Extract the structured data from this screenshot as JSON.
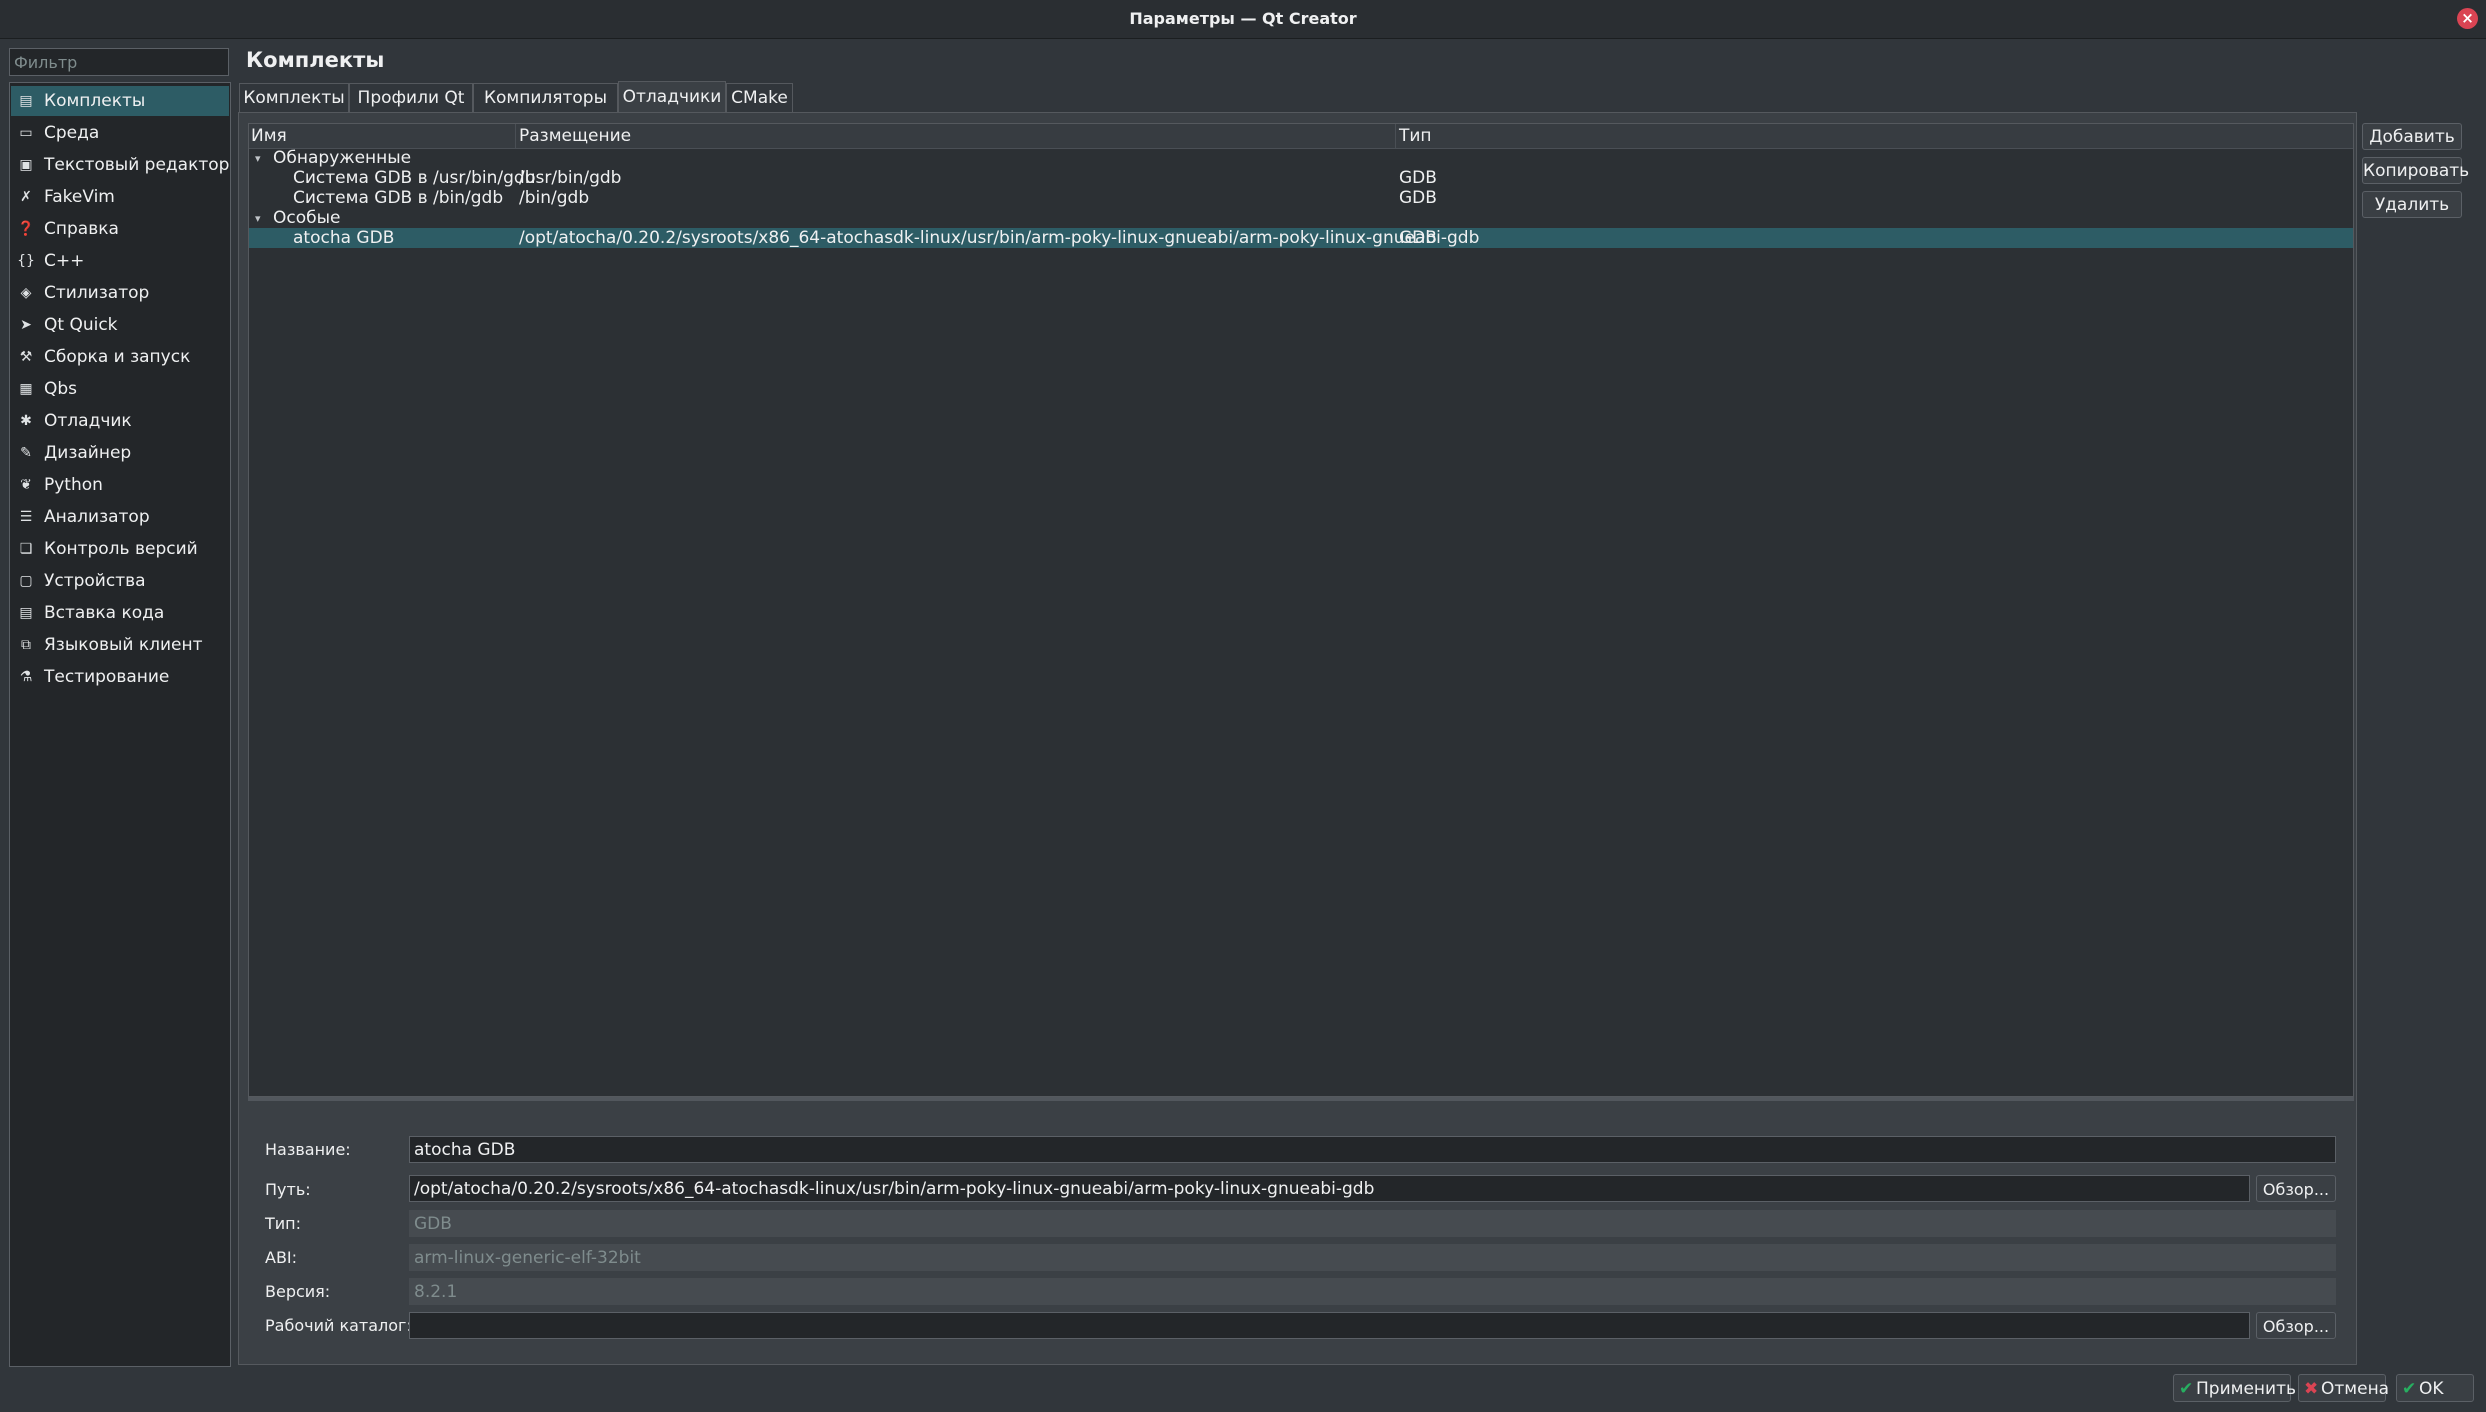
{
  "window": {
    "title": "Параметры — Qt Creator",
    "close_icon": "close-icon"
  },
  "sidebar": {
    "filter_placeholder": "Фильтр",
    "items": [
      {
        "label": "Комплекты",
        "icon": "kits-icon",
        "glyph": "▤"
      },
      {
        "label": "Среда",
        "icon": "monitor-icon",
        "glyph": "▭"
      },
      {
        "label": "Текстовый редактор",
        "icon": "text-editor-icon",
        "glyph": "▣"
      },
      {
        "label": "FakeVim",
        "icon": "fakevim-icon",
        "glyph": "✗"
      },
      {
        "label": "Справка",
        "icon": "help-icon",
        "glyph": "❓"
      },
      {
        "label": "C++",
        "icon": "braces-icon",
        "glyph": "{}"
      },
      {
        "label": "Стилизатор",
        "icon": "diamond-icon",
        "glyph": "◈"
      },
      {
        "label": "Qt Quick",
        "icon": "send-icon",
        "glyph": "➤"
      },
      {
        "label": "Сборка и запуск",
        "icon": "hammer-icon",
        "glyph": "⚒"
      },
      {
        "label": "Qbs",
        "icon": "qbs-icon",
        "glyph": "▦"
      },
      {
        "label": "Отладчик",
        "icon": "bug-icon",
        "glyph": "✱"
      },
      {
        "label": "Дизайнер",
        "icon": "pencil-icon",
        "glyph": "✎"
      },
      {
        "label": "Python",
        "icon": "python-icon",
        "glyph": "❦"
      },
      {
        "label": "Анализатор",
        "icon": "analyzer-icon",
        "glyph": "☰"
      },
      {
        "label": "Контроль версий",
        "icon": "version-control-icon",
        "glyph": "❏"
      },
      {
        "label": "Устройства",
        "icon": "devices-icon",
        "glyph": "▢"
      },
      {
        "label": "Вставка кода",
        "icon": "code-paste-icon",
        "glyph": "▤"
      },
      {
        "label": "Языковый клиент",
        "icon": "language-client-icon",
        "glyph": "⧉"
      },
      {
        "label": "Тестирование",
        "icon": "testing-icon",
        "glyph": "⚗"
      }
    ]
  },
  "main": {
    "heading": "Комплекты",
    "tabs": [
      {
        "label": "Комплекты"
      },
      {
        "label": "Профили Qt"
      },
      {
        "label": "Компиляторы"
      },
      {
        "label": "Отладчики"
      },
      {
        "label": "CMake"
      }
    ],
    "tree": {
      "columns": [
        "Имя",
        "Размещение",
        "Тип"
      ],
      "group1": "Обнаруженные",
      "group2": "Особые",
      "rows": [
        {
          "name": "Система GDB в /usr/bin/gdb",
          "location": "/usr/bin/gdb",
          "type": "GDB"
        },
        {
          "name": "Система GDB в /bin/gdb",
          "location": "/bin/gdb",
          "type": "GDB"
        },
        {
          "name": "atocha GDB",
          "location": "/opt/atocha/0.20.2/sysroots/x86_64-atochasdk-linux/usr/bin/arm-poky-linux-gnueabi/arm-poky-linux-gnueabi-gdb",
          "type": "GDB"
        }
      ]
    },
    "buttons": {
      "add": "Добавить",
      "copy": "Копировать",
      "remove": "Удалить"
    },
    "details": {
      "name_label": "Название:",
      "name_value": "atocha GDB",
      "path_label": "Путь:",
      "path_value": "/opt/atocha/0.20.2/sysroots/x86_64-atochasdk-linux/usr/bin/arm-poky-linux-gnueabi/arm-poky-linux-gnueabi-gdb",
      "browse": "Обзор...",
      "type_label": "Тип:",
      "type_value": "GDB",
      "abi_label": "ABI:",
      "abi_value": "arm-linux-generic-elf-32bit",
      "version_label": "Версия:",
      "version_value": "8.2.1",
      "workdir_label": "Рабочий каталог:",
      "workdir_value": ""
    }
  },
  "footer": {
    "apply": "Применить",
    "cancel": "Отмена",
    "ok": "OK"
  },
  "colors": {
    "selection": "#2d5c65",
    "background": "#31363b",
    "close": "#da4453"
  }
}
